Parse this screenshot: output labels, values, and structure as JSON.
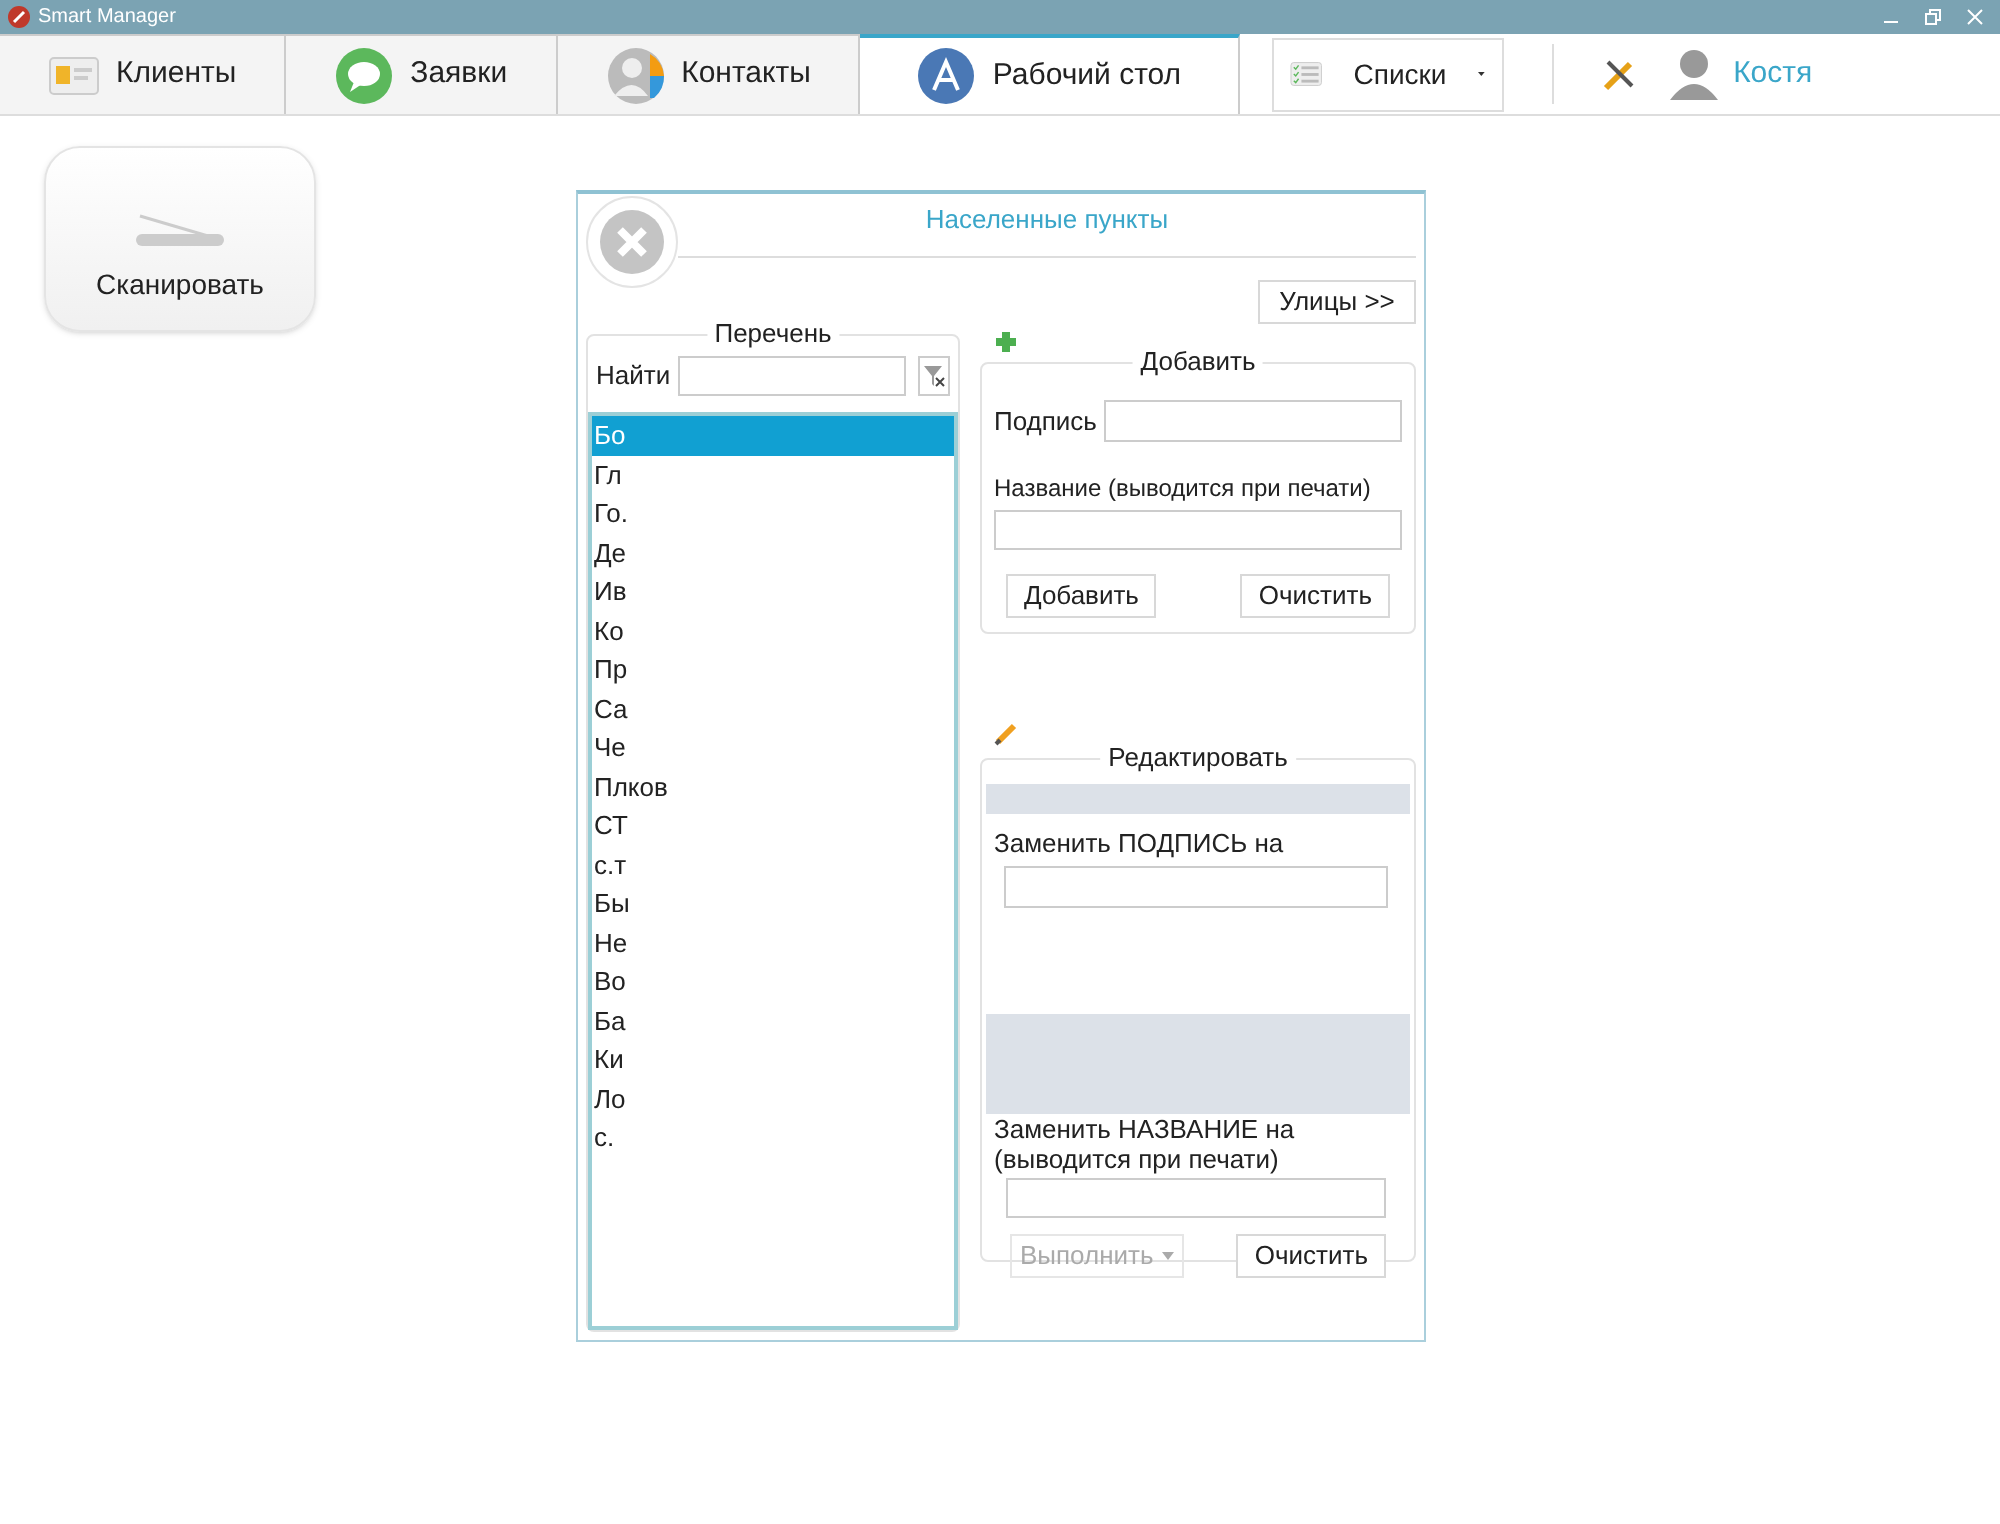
{
  "window": {
    "title": "Smart Manager"
  },
  "tabs": [
    {
      "label": "Клиенты",
      "selected": false,
      "kind": "card"
    },
    {
      "label": "Заявки",
      "selected": false,
      "kind": "chat"
    },
    {
      "label": "Контакты",
      "selected": false,
      "kind": "person"
    },
    {
      "label": "Рабочий стол",
      "selected": true,
      "kind": "apps"
    }
  ],
  "lists_button": {
    "label": "Списки"
  },
  "user": {
    "name": "Костя"
  },
  "scan_button": {
    "label": "Сканировать"
  },
  "dialog": {
    "title": "Населенные пункты",
    "streets_button": "Улицы >>",
    "list_panel": {
      "legend": "Перечень",
      "search_label": "Найти",
      "items": [
        {
          "text": "Бо",
          "selected": true
        },
        {
          "text": "Гл",
          "selected": false
        },
        {
          "text": "Го.",
          "selected": false
        },
        {
          "text": "Де",
          "selected": false
        },
        {
          "text": "Ив",
          "selected": false
        },
        {
          "text": "Ко",
          "selected": false
        },
        {
          "text": "Пр",
          "selected": false
        },
        {
          "text": "Са",
          "selected": false
        },
        {
          "text": "Че",
          "selected": false
        },
        {
          "text": "Плков",
          "selected": false
        },
        {
          "text": "СТ",
          "selected": false
        },
        {
          "text": "с.т",
          "selected": false
        },
        {
          "text": "Бы",
          "selected": false
        },
        {
          "text": "Не",
          "selected": false
        },
        {
          "text": "Во",
          "selected": false
        },
        {
          "text": "Ба",
          "selected": false
        },
        {
          "text": "Ки",
          "selected": false
        },
        {
          "text": "Ло",
          "selected": false
        },
        {
          "text": "с.",
          "selected": false
        }
      ]
    },
    "add_panel": {
      "legend": "Добавить",
      "caption_label": "Подпись",
      "name_label": "Название (выводится при печати)",
      "add_button": "Добавить",
      "clear_button": "Очистить"
    },
    "edit_panel": {
      "legend": "Редактировать",
      "replace_caption_label": "Заменить ПОДПИСЬ на",
      "replace_name_label": "Заменить НАЗВАНИЕ на (выводится при печати)",
      "execute_button": {
        "label": "Выполнить",
        "disabled": true
      },
      "clear_button": "Очистить"
    }
  }
}
